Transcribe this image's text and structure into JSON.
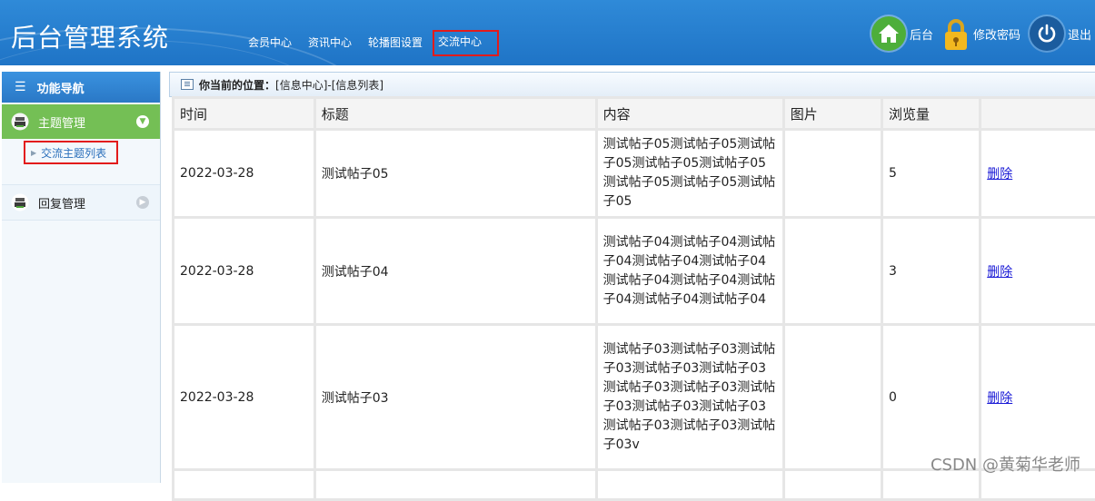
{
  "header": {
    "title": "后台管理系统",
    "nav": [
      "会员中心",
      "资讯中心",
      "轮播图设置",
      "交流中心"
    ],
    "active_nav": "交流中心",
    "right": {
      "home_label": "后台",
      "password_label": "修改密码",
      "logout_label": "退出"
    }
  },
  "sidebar": {
    "heading": "功能导航",
    "groups": [
      {
        "label": "主题管理",
        "expanded": true,
        "items": [
          "交流主题列表"
        ]
      },
      {
        "label": "回复管理",
        "expanded": false
      }
    ]
  },
  "breadcrumb": {
    "label": "你当前的位置：",
    "path": "[信息中心]-[信息列表]"
  },
  "table": {
    "columns": [
      "时间",
      "标题",
      "内容",
      "图片",
      "浏览量",
      ""
    ],
    "rows": [
      {
        "time": "2022-03-28",
        "title": "测试帖子05",
        "content": "测试帖子05测试帖子05测试帖子05测试帖子05测试帖子05测试帖子05测试帖子05测试帖子05",
        "image": "",
        "views": "5",
        "action": "删除"
      },
      {
        "time": "2022-03-28",
        "title": "测试帖子04",
        "content": "测试帖子04测试帖子04测试帖子04测试帖子04测试帖子04测试帖子04测试帖子04测试帖子04测试帖子04测试帖子04",
        "image": "",
        "views": "3",
        "action": "删除"
      },
      {
        "time": "2022-03-28",
        "title": "测试帖子03",
        "content": "测试帖子03测试帖子03测试帖子03测试帖子03测试帖子03测试帖子03测试帖子03测试帖子03测试帖子03测试帖子03测试帖子03测试帖子03测试帖子03v",
        "image": "",
        "views": "0",
        "action": "删除"
      }
    ]
  },
  "watermark": "CSDN @黄菊华老师",
  "colors": {
    "header": "#1f74c6",
    "active_group": "#74bf55",
    "highlight_box": "#e21b1b"
  }
}
